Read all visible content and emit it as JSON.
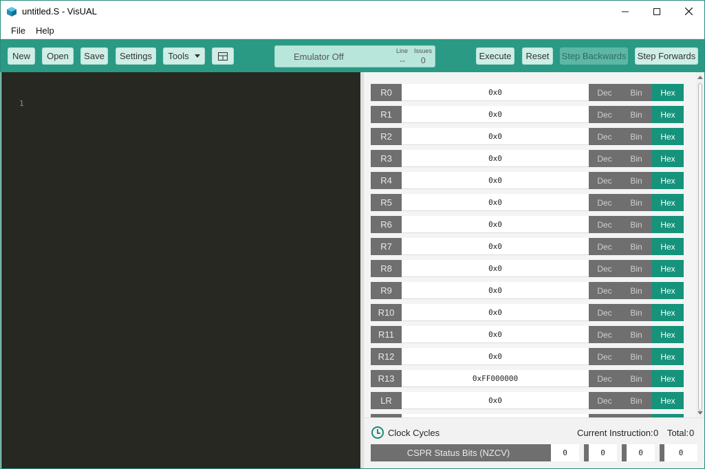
{
  "window": {
    "title": "untitled.S - VisUAL"
  },
  "menu": [
    "File",
    "Help"
  ],
  "toolbar": {
    "new": "New",
    "open": "Open",
    "save": "Save",
    "settings": "Settings",
    "tools": "Tools",
    "status": "Emulator Off",
    "line_label": "Line",
    "issues_label": "Issues",
    "line_value": "--",
    "issues_value": "0",
    "execute": "Execute",
    "reset": "Reset",
    "step_backwards": "Step Backwards",
    "step_forwards": "Step Forwards"
  },
  "editor": {
    "line_numbers": [
      "1"
    ]
  },
  "registers": [
    {
      "name": "R0",
      "value": "0x0"
    },
    {
      "name": "R1",
      "value": "0x0"
    },
    {
      "name": "R2",
      "value": "0x0"
    },
    {
      "name": "R3",
      "value": "0x0"
    },
    {
      "name": "R4",
      "value": "0x0"
    },
    {
      "name": "R5",
      "value": "0x0"
    },
    {
      "name": "R6",
      "value": "0x0"
    },
    {
      "name": "R7",
      "value": "0x0"
    },
    {
      "name": "R8",
      "value": "0x0"
    },
    {
      "name": "R9",
      "value": "0x0"
    },
    {
      "name": "R10",
      "value": "0x0"
    },
    {
      "name": "R11",
      "value": "0x0"
    },
    {
      "name": "R12",
      "value": "0x0"
    },
    {
      "name": "R13",
      "value": "0xFF000000"
    },
    {
      "name": "LR",
      "value": "0x0"
    }
  ],
  "formats": [
    "Dec",
    "Bin",
    "Hex"
  ],
  "active_format": "Hex",
  "status": {
    "clock_label": "Clock Cycles",
    "current_instruction_label": "Current Instruction:",
    "current_instruction_value": "0",
    "total_label": "Total:",
    "total_value": "0",
    "cspr_label": "CSPR Status Bits (NZCV)",
    "cspr_bits": [
      "0",
      "0",
      "0",
      "0"
    ]
  },
  "colors": {
    "accent": "#2a9a85",
    "active_format": "#15937b",
    "editor_bg": "#272822"
  }
}
